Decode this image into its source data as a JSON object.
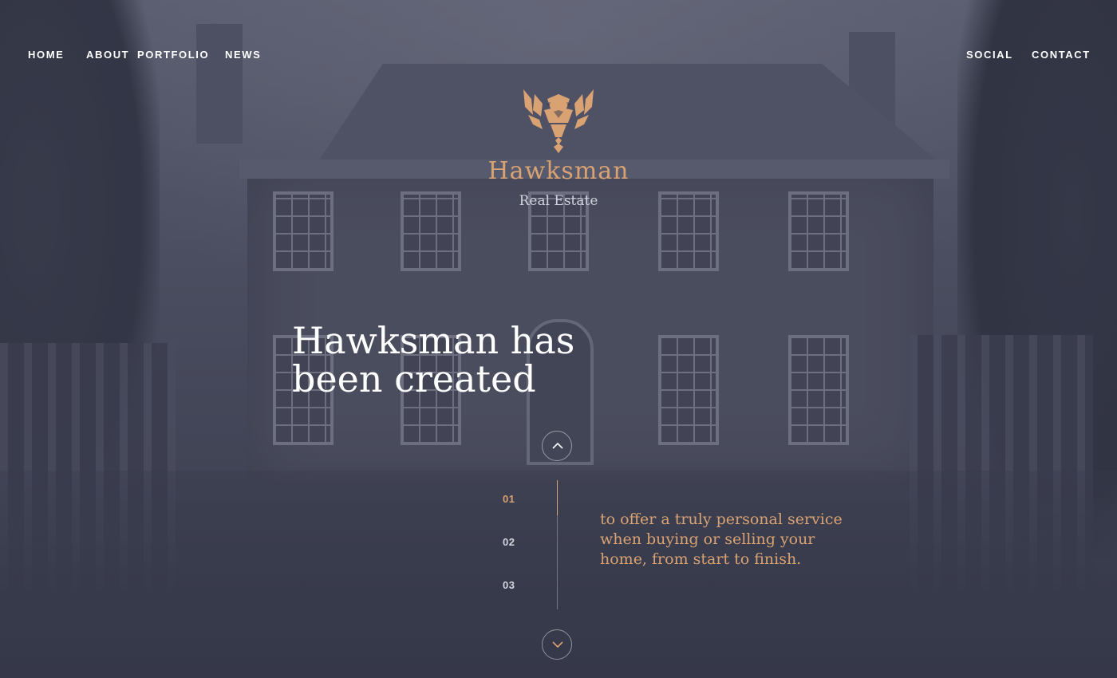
{
  "nav": {
    "left": [
      "HOME",
      "ABOUT",
      "PORTFOLIO",
      "NEWS"
    ],
    "right": [
      "SOCIAL",
      "CONTACT"
    ]
  },
  "logo": {
    "icon": "hawk-emblem-icon",
    "title": "Hawksman",
    "subtitle": "Real Estate"
  },
  "hero": {
    "headline_line1": "Hawksman has",
    "headline_line2": "been created",
    "tagline_line1": "to offer a truly personal service",
    "tagline_line2": "when buying or selling your",
    "tagline_line3": "home, from start to finish."
  },
  "slider": {
    "numbers": [
      "01",
      "02",
      "03"
    ],
    "active_index": 0,
    "prev_icon": "chevron-up-icon",
    "next_icon": "chevron-down-icon"
  },
  "colors": {
    "accent": "#d9a273",
    "text": "#ffffff",
    "overlay": "#3a3d4d"
  }
}
